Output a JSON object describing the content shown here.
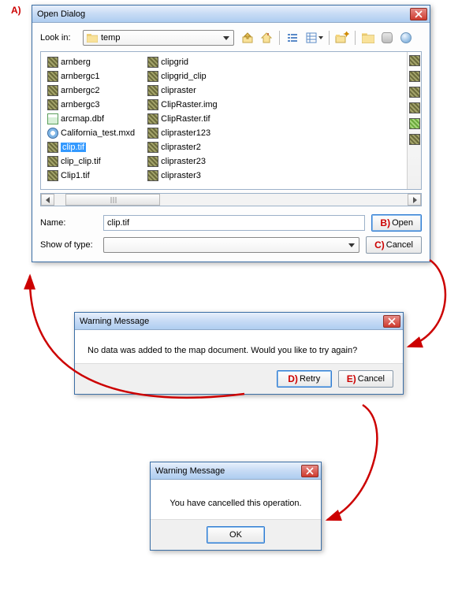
{
  "labels": {
    "A": "A)",
    "B": "B)",
    "C": "C)",
    "D": "D)",
    "E": "E)"
  },
  "openDialog": {
    "title": "Open Dialog",
    "lookInLabel": "Look in:",
    "lookInValue": "temp",
    "nameLabel": "Name:",
    "nameValue": "clip.tif",
    "typeLabel": "Show of type:",
    "typeValue": "",
    "openBtn": "Open",
    "cancelBtn": "Cancel",
    "files_col1": [
      {
        "name": "arnberg",
        "icon": "rast"
      },
      {
        "name": "arnbergc1",
        "icon": "rast"
      },
      {
        "name": "arnbergc2",
        "icon": "rast"
      },
      {
        "name": "arnbergc3",
        "icon": "rast"
      },
      {
        "name": "arcmap.dbf",
        "icon": "dbf"
      },
      {
        "name": "California_test.mxd",
        "icon": "mxd"
      },
      {
        "name": "clip.tif",
        "icon": "rast",
        "selected": true
      },
      {
        "name": "clip_clip.tif",
        "icon": "rast"
      },
      {
        "name": "Clip1.tif",
        "icon": "rast"
      }
    ],
    "files_col2": [
      {
        "name": "clipgrid",
        "icon": "rast"
      },
      {
        "name": "clipgrid_clip",
        "icon": "rast"
      },
      {
        "name": "clipraster",
        "icon": "rast"
      },
      {
        "name": "ClipRaster.img",
        "icon": "rast"
      },
      {
        "name": "ClipRaster.tif",
        "icon": "rast"
      },
      {
        "name": "clipraster123",
        "icon": "rast"
      },
      {
        "name": "clipraster2",
        "icon": "rast"
      },
      {
        "name": "clipraster23",
        "icon": "rast"
      },
      {
        "name": "clipraster3",
        "icon": "rast"
      }
    ]
  },
  "warn1": {
    "title": "Warning Message",
    "msg": "No data was added to the map document.  Would you like to try again?",
    "retry": "Retry",
    "cancel": "Cancel"
  },
  "warn2": {
    "title": "Warning Message",
    "msg": "You have cancelled this operation.",
    "ok": "OK"
  }
}
